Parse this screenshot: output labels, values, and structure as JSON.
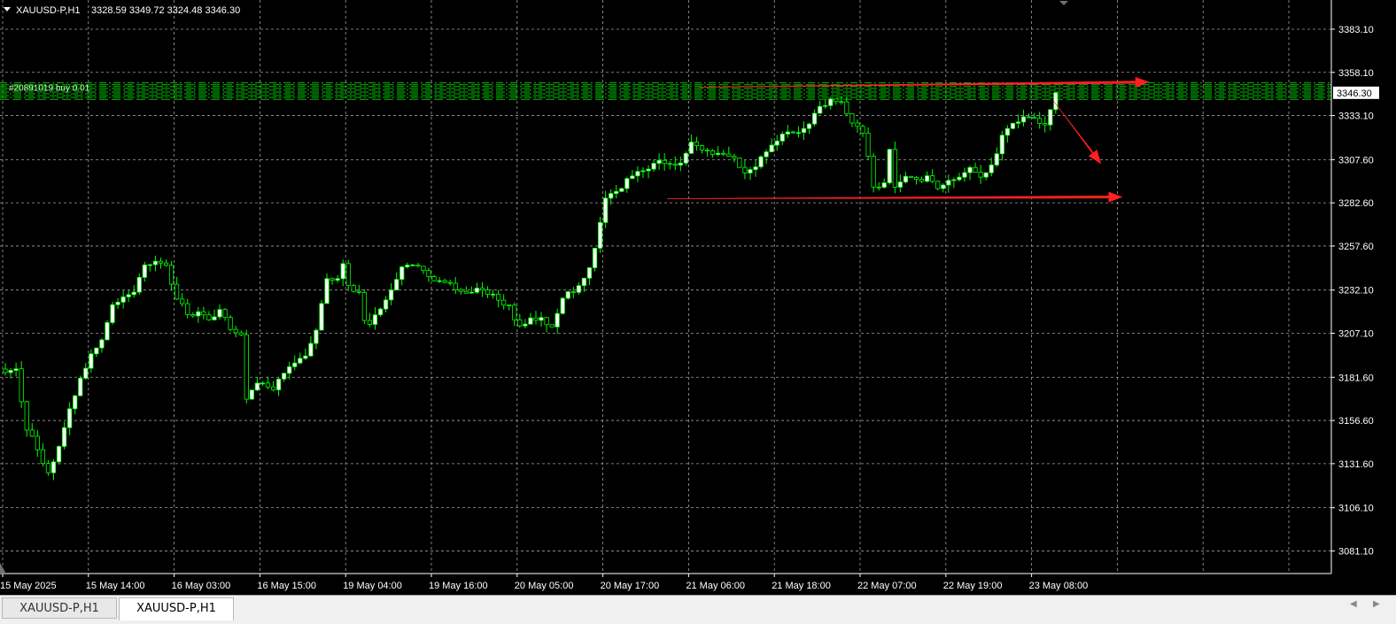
{
  "header": {
    "symbol": "XAUUSD-P,H1",
    "ohlc": "3328.59 3349.72 3324.48 3346.30"
  },
  "tabs": [
    {
      "label": "XAUUSD-P,H1",
      "active": false
    },
    {
      "label": "XAUUSD-P,H1",
      "active": true
    }
  ],
  "colors": {
    "background": "#000000",
    "grid": "#a0a0a0",
    "candle": "#00ff00",
    "bull_body": "#ffffff",
    "bear_body": "#000000",
    "order_lines": "#00c000",
    "annotation_arrows": "#ff2020",
    "axis_text": "#ffffff"
  },
  "chart_data": {
    "type": "candlestick",
    "symbol": "XAUUSD-P",
    "timeframe": "H1",
    "current_price": 3346.3,
    "current_price_label": "3346.30",
    "ylim": [
      3068,
      3400
    ],
    "y_ticks": [
      {
        "value": 3383.1,
        "label": "3383.10"
      },
      {
        "value": 3358.1,
        "label": "3358.10"
      },
      {
        "value": 3333.1,
        "label": "3333.10"
      },
      {
        "value": 3307.6,
        "label": "3307.60"
      },
      {
        "value": 3282.6,
        "label": "3282.60"
      },
      {
        "value": 3257.6,
        "label": "3257.60"
      },
      {
        "value": 3232.1,
        "label": "3232.10"
      },
      {
        "value": 3207.1,
        "label": "3207.10"
      },
      {
        "value": 3181.6,
        "label": "3181.60"
      },
      {
        "value": 3156.6,
        "label": "3156.60"
      },
      {
        "value": 3131.6,
        "label": "3131.60"
      },
      {
        "value": 3106.1,
        "label": "3106.10"
      },
      {
        "value": 3081.1,
        "label": "3081.10"
      }
    ],
    "x_ticks": [
      {
        "bar": 0,
        "label": "15 May 2025"
      },
      {
        "bar": 16,
        "label": "15 May 14:00"
      },
      {
        "bar": 32,
        "label": "16 May 03:00"
      },
      {
        "bar": 48,
        "label": "16 May 15:00"
      },
      {
        "bar": 64,
        "label": "19 May 04:00"
      },
      {
        "bar": 80,
        "label": "19 May 16:00"
      },
      {
        "bar": 96,
        "label": "20 May 05:00"
      },
      {
        "bar": 112,
        "label": "20 May 17:00"
      },
      {
        "bar": 128,
        "label": "21 May 06:00"
      },
      {
        "bar": 144,
        "label": "21 May 18:00"
      },
      {
        "bar": 160,
        "label": "22 May 07:00"
      },
      {
        "bar": 176,
        "label": "22 May 19:00"
      },
      {
        "bar": 192,
        "label": "23 May 08:00"
      }
    ],
    "bars": 200,
    "path": [
      [
        0,
        3185
      ],
      [
        2,
        3185
      ],
      [
        4,
        3152
      ],
      [
        6,
        3140
      ],
      [
        8,
        3125
      ],
      [
        10,
        3142
      ],
      [
        12,
        3165
      ],
      [
        14,
        3180
      ],
      [
        16,
        3195
      ],
      [
        18,
        3205
      ],
      [
        20,
        3225
      ],
      [
        22,
        3228
      ],
      [
        24,
        3232
      ],
      [
        26,
        3245
      ],
      [
        28,
        3250
      ],
      [
        30,
        3245
      ],
      [
        32,
        3228
      ],
      [
        34,
        3218
      ],
      [
        36,
        3218
      ],
      [
        38,
        3215
      ],
      [
        40,
        3220
      ],
      [
        42,
        3210
      ],
      [
        44,
        3205
      ],
      [
        45,
        3168
      ],
      [
        46,
        3175
      ],
      [
        48,
        3180
      ],
      [
        50,
        3175
      ],
      [
        52,
        3185
      ],
      [
        54,
        3190
      ],
      [
        56,
        3193
      ],
      [
        58,
        3210
      ],
      [
        60,
        3238
      ],
      [
        62,
        3240
      ],
      [
        63,
        3248
      ],
      [
        64,
        3235
      ],
      [
        66,
        3230
      ],
      [
        67,
        3215
      ],
      [
        68,
        3213
      ],
      [
        70,
        3222
      ],
      [
        72,
        3232
      ],
      [
        74,
        3245
      ],
      [
        76,
        3246
      ],
      [
        78,
        3243
      ],
      [
        80,
        3238
      ],
      [
        82,
        3235
      ],
      [
        84,
        3234
      ],
      [
        86,
        3232
      ],
      [
        88,
        3233
      ],
      [
        90,
        3230
      ],
      [
        92,
        3226
      ],
      [
        94,
        3222
      ],
      [
        96,
        3210
      ],
      [
        98,
        3215
      ],
      [
        100,
        3215
      ],
      [
        102,
        3212
      ],
      [
        104,
        3228
      ],
      [
        106,
        3232
      ],
      [
        108,
        3238
      ],
      [
        110,
        3255
      ],
      [
        112,
        3285
      ],
      [
        114,
        3288
      ],
      [
        116,
        3295
      ],
      [
        118,
        3300
      ],
      [
        120,
        3302
      ],
      [
        122,
        3308
      ],
      [
        124,
        3305
      ],
      [
        126,
        3306
      ],
      [
        128,
        3318
      ],
      [
        130,
        3312
      ],
      [
        132,
        3310
      ],
      [
        134,
        3312
      ],
      [
        136,
        3308
      ],
      [
        138,
        3300
      ],
      [
        140,
        3305
      ],
      [
        142,
        3312
      ],
      [
        144,
        3320
      ],
      [
        146,
        3322
      ],
      [
        148,
        3324
      ],
      [
        150,
        3328
      ],
      [
        152,
        3338
      ],
      [
        154,
        3343
      ],
      [
        156,
        3340
      ],
      [
        158,
        3330
      ],
      [
        160,
        3322
      ],
      [
        161,
        3310
      ],
      [
        162,
        3290
      ],
      [
        164,
        3295
      ],
      [
        165,
        3312
      ],
      [
        166,
        3290
      ],
      [
        168,
        3298
      ],
      [
        170,
        3295
      ],
      [
        172,
        3297
      ],
      [
        174,
        3290
      ],
      [
        176,
        3295
      ],
      [
        178,
        3298
      ],
      [
        180,
        3302
      ],
      [
        182,
        3298
      ],
      [
        184,
        3305
      ],
      [
        186,
        3320
      ],
      [
        188,
        3330
      ],
      [
        190,
        3332
      ],
      [
        192,
        3330
      ],
      [
        194,
        3328
      ],
      [
        196,
        3346
      ]
    ],
    "order_lines": {
      "count": 10,
      "price_min": 3342.5,
      "price_max": 3352.0,
      "labels": [
        "#20891019 buy 0.01"
      ]
    },
    "annotations": [
      {
        "type": "arrow",
        "from": [
          130,
          3349.5
        ],
        "to": [
          214,
          3352.5
        ]
      },
      {
        "type": "arrow",
        "from": [
          196,
          3342
        ],
        "to": [
          205,
          3305
        ]
      },
      {
        "type": "arrow",
        "from": [
          124,
          3285
        ],
        "to": [
          209,
          3286
        ]
      }
    ]
  }
}
